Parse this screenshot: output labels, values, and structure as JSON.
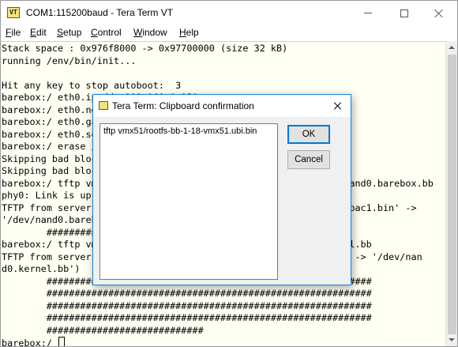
{
  "window": {
    "app_icon_text": "VT",
    "title": "COM1:115200baud - Tera Term VT"
  },
  "menu": [
    {
      "key": "F",
      "rest": "ile"
    },
    {
      "key": "E",
      "rest": "dit"
    },
    {
      "key": "S",
      "rest": "etup"
    },
    {
      "key": "C",
      "rest": "ontrol"
    },
    {
      "key": "W",
      "rest": "indow"
    },
    {
      "key": "H",
      "rest": "elp"
    }
  ],
  "terminal": {
    "lines": [
      "Stack space : 0x976f8000 -> 0x97700000 (size 32 kB)",
      "running /env/bin/init...",
      "",
      "Hit any key to stop autoboot:  3",
      "barebox:/ eth0.ipaddr=192.168.0.150",
      "barebox:/ eth0.ne",
      "barebox:/ eth0.ga",
      "barebox:/ eth0.se",
      "barebox:/ erase /",
      "Skipping bad bloc",
      "Skipping bad bloc",
      "barebox:/ tftp vm                                           /nand0.barebox.bb",
      "phy0: Link is up",
      "TFTP from server                                          2M-vpac1.bin' ->",
      "'/dev/nand0.bareb",
      "        #########",
      "barebox:/ tftp vm                                          rnel.bb",
      "TFTP from server                                          bin' -> '/dev/nan",
      "d0.kernel.bb')",
      "        ##########################################################",
      "        ##########################################################",
      "        ##########################################################",
      "        ##########################################################",
      "        ############################"
    ],
    "prompt": "barebox:/ "
  },
  "dialog": {
    "title": "Tera Term: Clipboard confirmation",
    "clipboard_text": "tftp vmx51/rootfs-bb-1-18-vmx51.ubi.bin",
    "ok_label": "OK",
    "cancel_label": "Cancel"
  }
}
